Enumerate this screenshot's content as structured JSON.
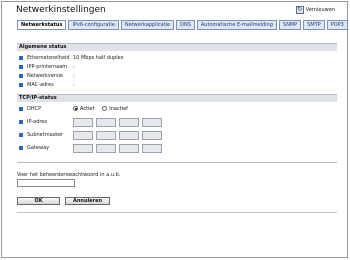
{
  "page": {
    "title": "Netwerkinstellingen",
    "refresh_label": "Vernieuwen"
  },
  "tabs": [
    {
      "label": "Netwerkstatus",
      "active": true
    },
    {
      "label": "IPv6-configuratie"
    },
    {
      "label": "Netwerkapplicatie"
    },
    {
      "label": "DNS"
    },
    {
      "label": "Automatische E-mailmelding"
    },
    {
      "label": "SNMP"
    },
    {
      "label": "SMTP"
    },
    {
      "label": "POP3"
    }
  ],
  "general_status": {
    "header": "Algemene status",
    "rows": [
      {
        "label": "Ethernetsnelheid",
        "value": "10 Mbps half duplex"
      },
      {
        "label": "IPP-printernaam",
        "value": ":"
      },
      {
        "label": "Netwerkversie",
        "value": ":"
      },
      {
        "label": "MAC-adres",
        "value": ":"
      }
    ]
  },
  "tcpip_status": {
    "header": "TCP/IP-status",
    "dhcp_label": "DHCP",
    "dhcp_options": {
      "active": "Actief",
      "inactive": "Inactief"
    },
    "ip_rows": [
      {
        "label": "IP-adres"
      },
      {
        "label": "Subnetmasker"
      },
      {
        "label": "Gateway"
      }
    ]
  },
  "password": {
    "label": "Voer het beheerderswachtwoord in a.u.b."
  },
  "buttons": {
    "ok": "OK",
    "cancel": "Annuleren"
  }
}
